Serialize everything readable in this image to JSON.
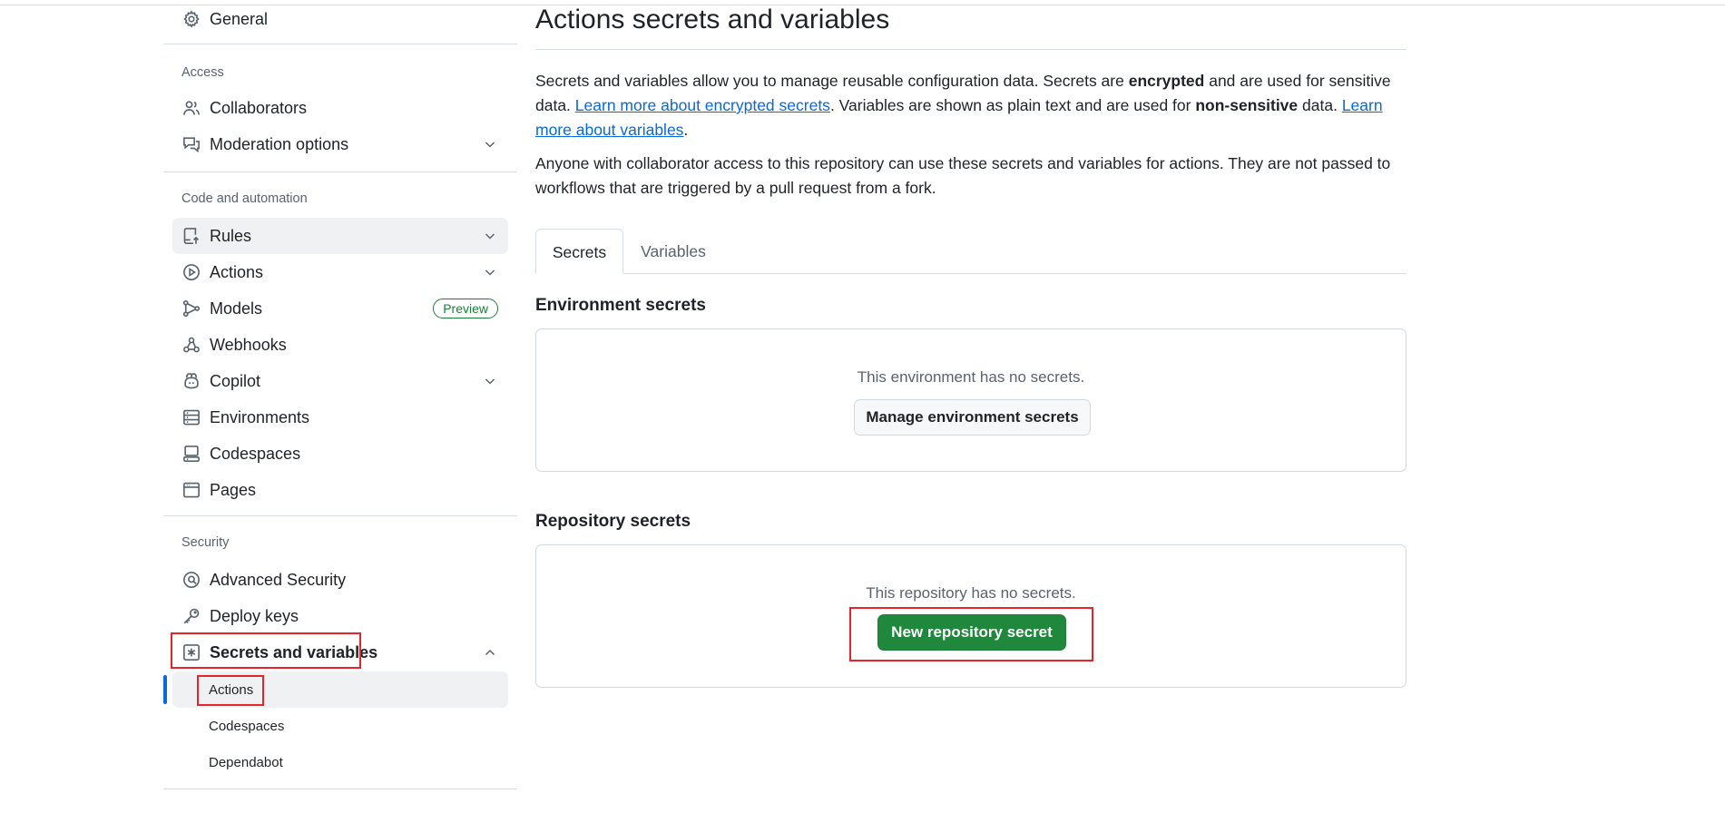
{
  "sidebar": {
    "general": "General",
    "access_title": "Access",
    "collaborators": "Collaborators",
    "moderation": "Moderation options",
    "code_title": "Code and automation",
    "rules": "Rules",
    "actions": "Actions",
    "models": "Models",
    "preview_badge": "Preview",
    "webhooks": "Webhooks",
    "copilot": "Copilot",
    "environments": "Environments",
    "codespaces": "Codespaces",
    "pages": "Pages",
    "security_title": "Security",
    "advanced_security": "Advanced Security",
    "deploy_keys": "Deploy keys",
    "secrets_variables": "Secrets and variables",
    "sub_actions": "Actions",
    "sub_codespaces": "Codespaces",
    "sub_dependabot": "Dependabot"
  },
  "main": {
    "title": "Actions secrets and variables",
    "intro_1": "Secrets and variables allow you to manage reusable configuration data. Secrets are ",
    "intro_bold_1": "encrypted",
    "intro_2": " and are used for sensitive data. ",
    "link_secrets": "Learn more about encrypted secrets",
    "intro_3": ". Variables are shown as plain text and are used for ",
    "intro_bold_2": "non-sensitive",
    "intro_4": " data. ",
    "link_variables": "Learn more about variables",
    "intro_5": ".",
    "note": "Anyone with collaborator access to this repository can use these secrets and variables for actions. They are not passed to workflows that are triggered by a pull request from a fork.",
    "tabs": [
      "Secrets",
      "Variables"
    ],
    "active_tab": "Secrets",
    "env_heading": "Environment secrets",
    "env_empty": "This environment has no secrets.",
    "env_button": "Manage environment secrets",
    "repo_heading": "Repository secrets",
    "repo_empty": "This repository has no secrets.",
    "repo_button": "New repository secret"
  },
  "colors": {
    "accent_link": "#0969da",
    "primary_button": "#1f883d",
    "preview_badge": "#1a7f37",
    "highlight_box": "#e5242b",
    "active_indicator": "#0969da"
  },
  "icons": [
    "gear-icon",
    "people-icon",
    "comment-discussion-icon",
    "repo-rules-icon",
    "play-icon",
    "models-icon",
    "webhook-icon",
    "copilot-icon",
    "server-icon",
    "codespaces-icon",
    "browser-icon",
    "shield-search-icon",
    "key-icon",
    "key-asterisk-icon",
    "chevron-down-icon",
    "chevron-up-icon"
  ]
}
